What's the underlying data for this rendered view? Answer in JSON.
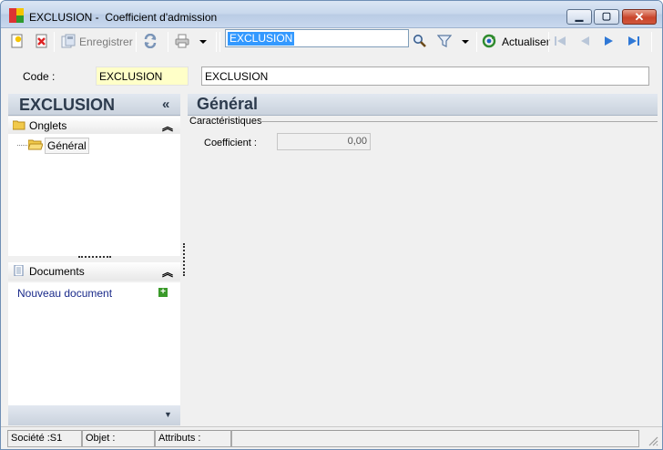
{
  "window": {
    "title_code": "EXCLUSION -",
    "title_desc": "Coefficient d'admission",
    "btn_minimize": "▁",
    "btn_maximize": "▢",
    "btn_close": "✕"
  },
  "toolbar": {
    "save_label": "Enregistrer",
    "search_value": "EXCLUSION",
    "refresh_label": "Actualiser"
  },
  "form": {
    "code_label": "Code :",
    "code_value": "EXCLUSION",
    "name_value": "EXCLUSION"
  },
  "left_panel": {
    "title": "EXCLUSION",
    "collapse_glyph": "«",
    "tabs_section": {
      "label": "Onglets",
      "chevron": "︽",
      "node": "Général"
    },
    "documents_section": {
      "label": "Documents",
      "chevron": "︽",
      "new_document_link": "Nouveau document",
      "add_glyph": "+"
    },
    "bottom_chevron": "▼"
  },
  "right_panel": {
    "title": "Général",
    "group_label": "Caractéristiques",
    "coefficient_label": "Coefficient :",
    "coefficient_value": "0,00"
  },
  "statusbar": {
    "societe": "Société :S1",
    "objet": "Objet :",
    "attributs": "Attributs :"
  },
  "colors": {
    "accent_blue": "#3399ff",
    "code_field_bg": "#ffffc8",
    "nav_arrows": "#2f78d6"
  }
}
